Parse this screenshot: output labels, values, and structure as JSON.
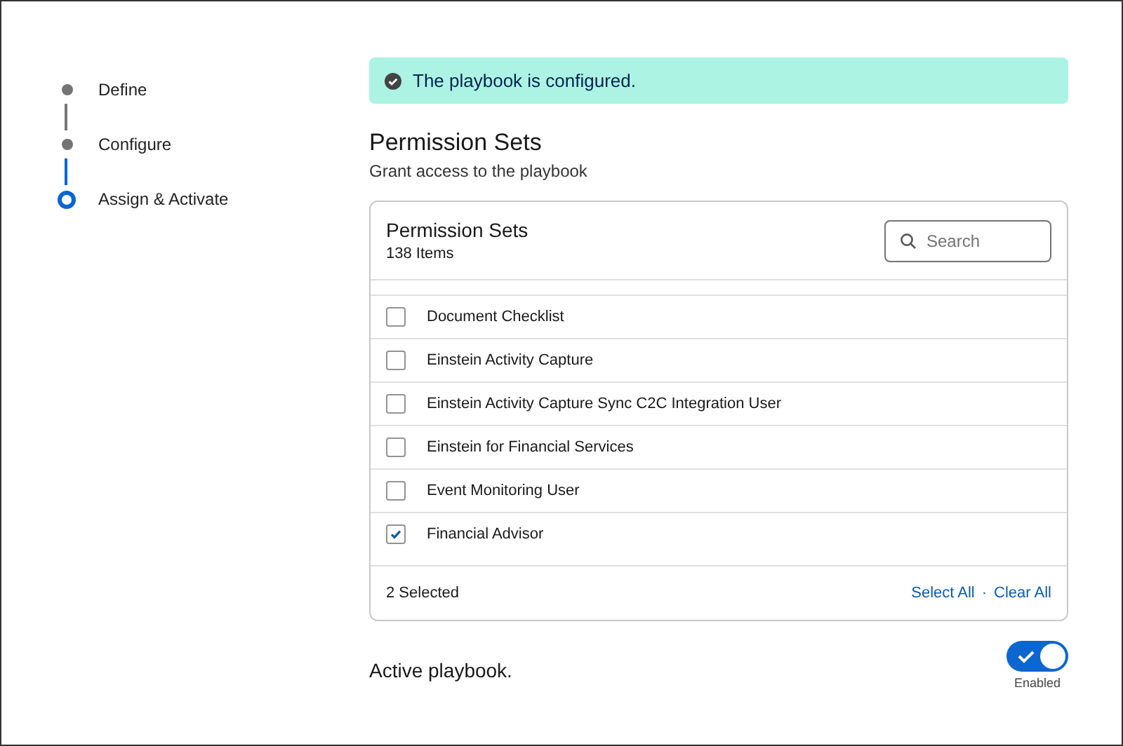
{
  "steps": [
    {
      "label": "Define",
      "current": false
    },
    {
      "label": "Configure",
      "current": false
    },
    {
      "label": "Assign & Activate",
      "current": true
    }
  ],
  "banner": {
    "text": "The playbook is configured."
  },
  "section": {
    "title": "Permission Sets",
    "subtitle": "Grant access to the playbook"
  },
  "card": {
    "title": "Permission Sets",
    "count": "138 Items",
    "search": {
      "placeholder": "Search"
    },
    "rows": [
      {
        "label": "Document Checklist",
        "checked": false
      },
      {
        "label": "Einstein Activity Capture",
        "checked": false
      },
      {
        "label": "Einstein Activity Capture Sync C2C Integration User",
        "checked": false
      },
      {
        "label": "Einstein for Financial Services",
        "checked": false
      },
      {
        "label": "Event Monitoring User",
        "checked": false
      },
      {
        "label": "Financial Advisor",
        "checked": true
      }
    ],
    "footer": {
      "selected": "2 Selected",
      "select_all": "Select All",
      "separator": "·",
      "clear_all": "Clear All"
    }
  },
  "active": {
    "label": "Active playbook.",
    "on": true,
    "status": "Enabled"
  }
}
